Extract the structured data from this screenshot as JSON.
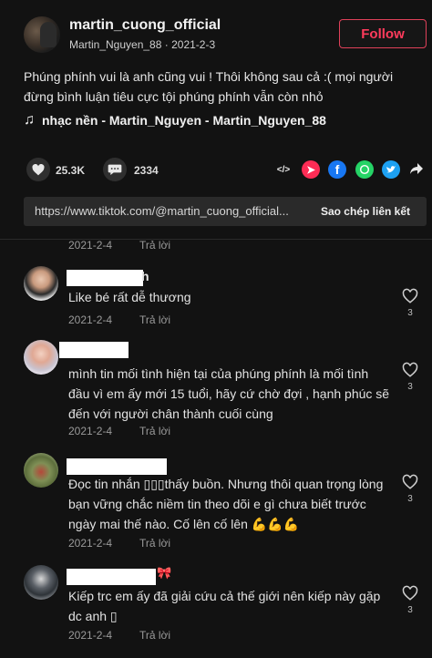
{
  "post": {
    "username": "martin_cuong_official",
    "author": "Martin_Nguyen_88",
    "date": "2021-2-3",
    "date_separator": "·",
    "follow_label": "Follow",
    "caption": "Phúng phính vui là anh cũng vui ! Thôi không sau cả :( mọi người đừng bình luận tiêu cực tội phúng phính vẫn còn nhỏ",
    "music_icon": "♫",
    "music": "nhạc nền - Martin_Nguyen - Martin_Nguyen_88"
  },
  "actions": {
    "likes": "25.3K",
    "comments": "2334",
    "share_icons": [
      "embed-icon",
      "send-icon",
      "facebook-icon",
      "whatsapp-icon",
      "twitter-icon",
      "share-arrow-icon"
    ]
  },
  "link": {
    "url": "https://www.tiktok.com/@martin_cuong_official...",
    "copy_label": "Sao chép liên kết"
  },
  "comments": {
    "partial": {
      "date": "2021-2-4",
      "reply": "Trả lời"
    },
    "items": [
      {
        "text": "Like bé rất dễ thương",
        "date": "2021-2-4",
        "reply": "Trả lời",
        "likes": "3",
        "name_suffix": "h"
      },
      {
        "text": "mình tin mối tình hiện tại của phúng phính là mối tình đầu vì em ấy mới 15 tuổi, hãy cứ chờ đợi , hạnh phúc sẽ đến với người chân thành cuối cùng",
        "date": "2021-2-4",
        "reply": "Trả lời",
        "likes": "3"
      },
      {
        "text": "Đọc tin nhắn ▯▯▯thấy buồn. Nhưng thôi quan trọng lòng bạn vững chắc niềm tin theo dõi e gì chưa biết trước ngày mai thế nào. Cố lên cố lên 💪💪💪",
        "date": "2021-2-4",
        "reply": "Trả lời",
        "likes": "3"
      },
      {
        "text": "Kiếp trc em ấy đã giải cứu cả thế giới nên kiếp này gặp dc anh ▯",
        "date": "2021-2-4",
        "reply": "Trả lời",
        "likes": "3",
        "name_suffix": "🎀"
      }
    ]
  },
  "colors": {
    "background": "#121212",
    "follow_accent": "#ff3b5c",
    "facebook": "#1877f2",
    "whatsapp": "#25d366",
    "twitter": "#1da1f2",
    "send": "#fe2c55"
  }
}
